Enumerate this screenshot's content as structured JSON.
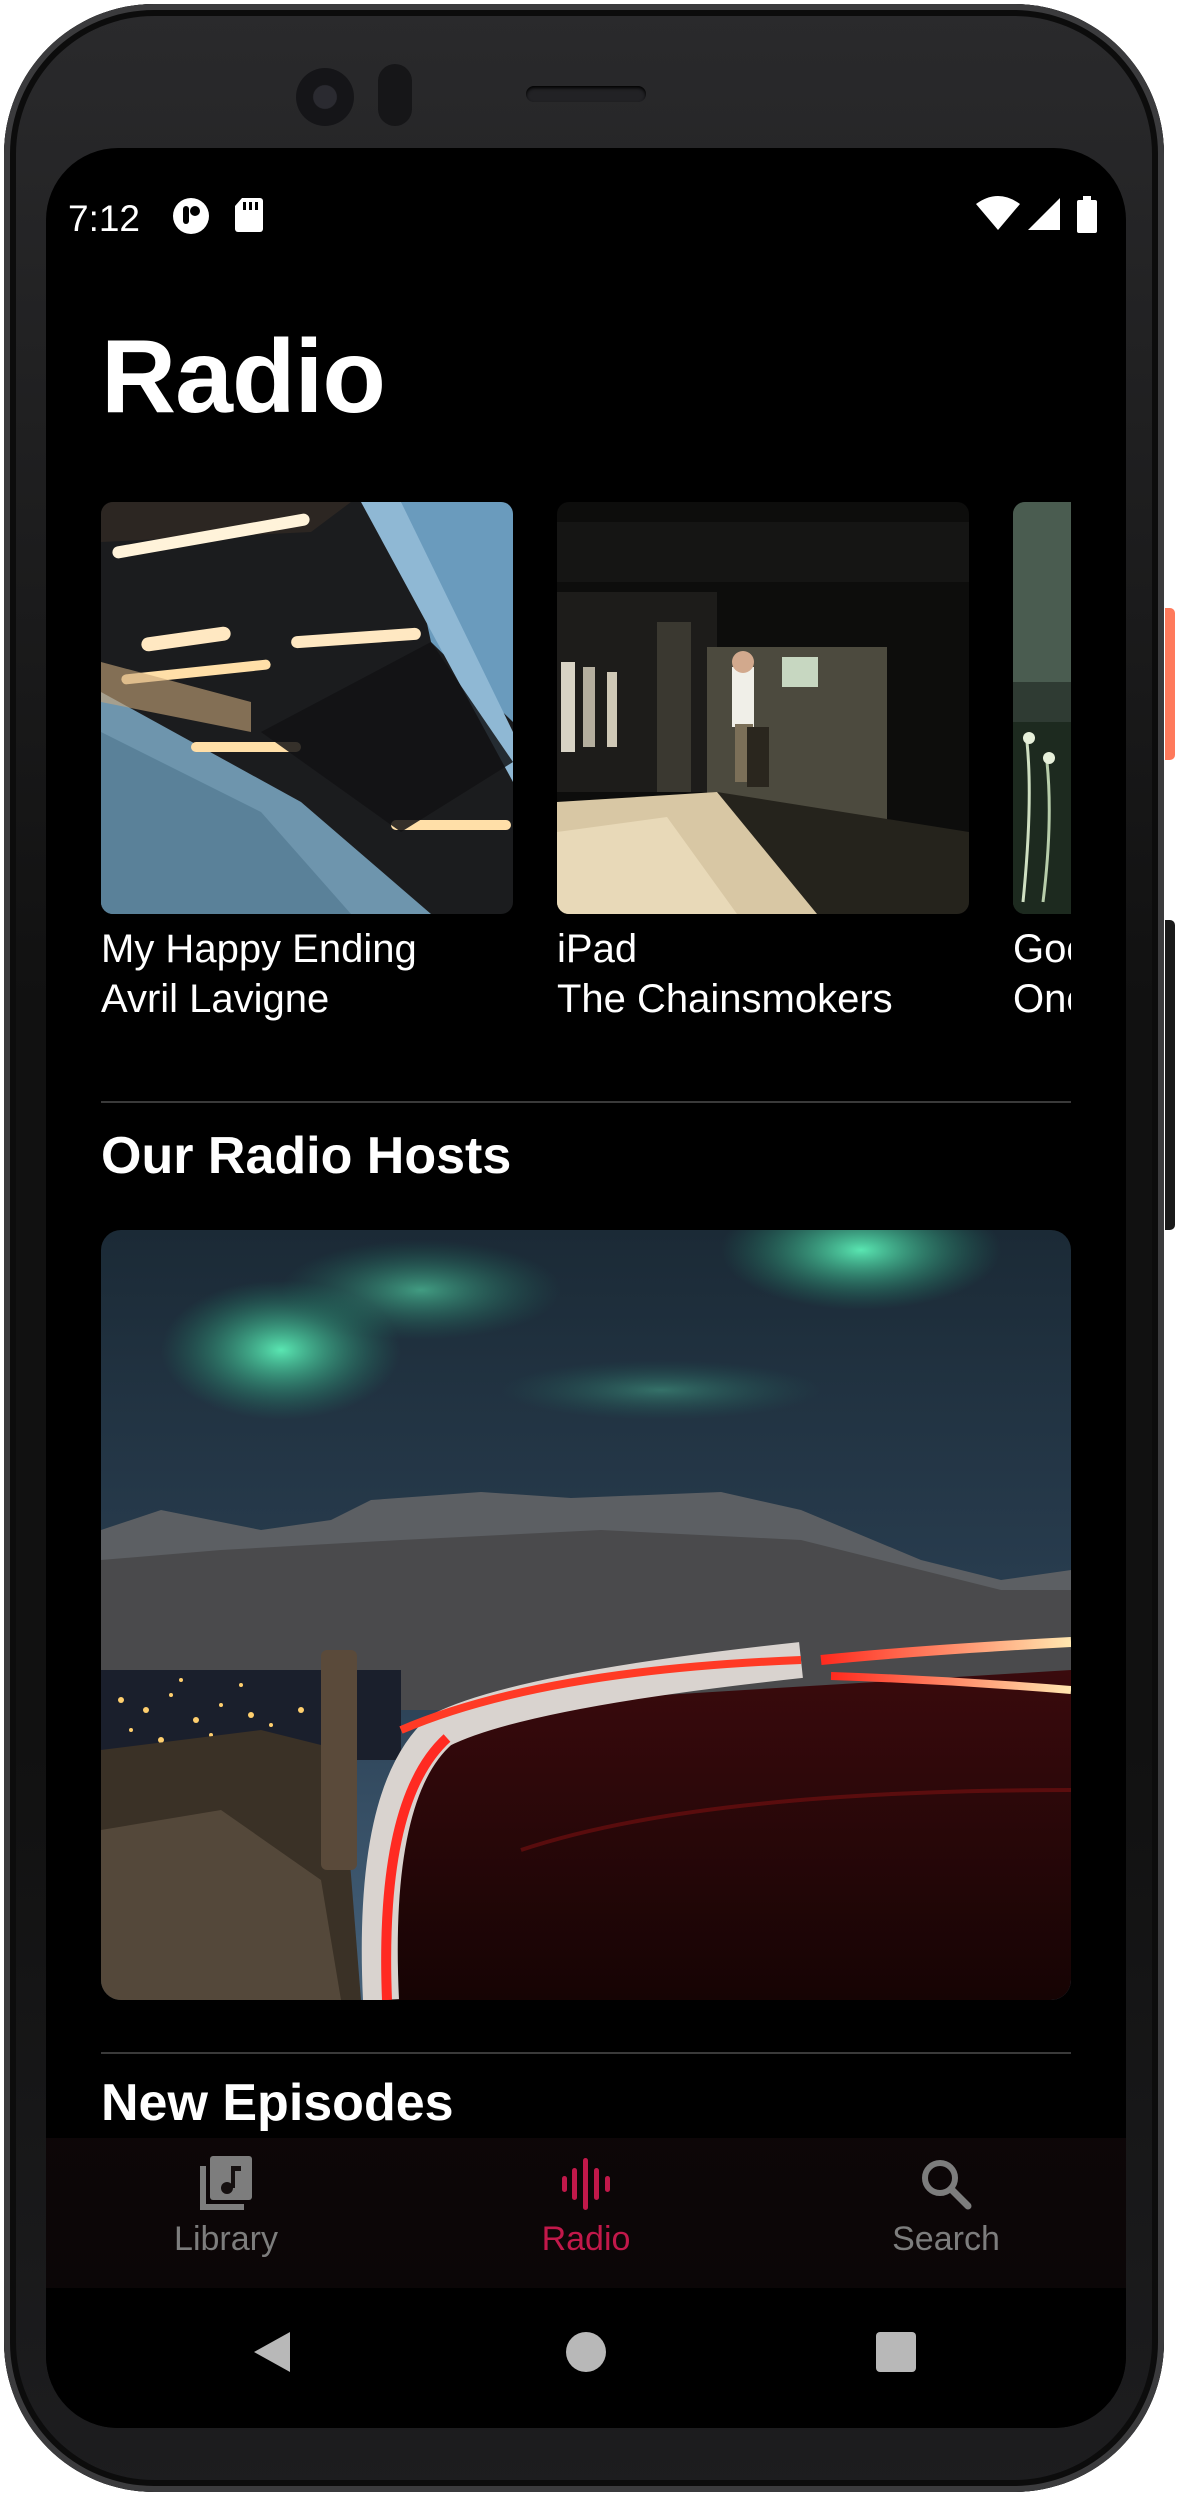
{
  "status_bar": {
    "time": "7:12",
    "left_icons": [
      "assistant-icon",
      "sd-card-icon"
    ],
    "right_icons": [
      "wifi-icon",
      "signal-icon",
      "battery-icon"
    ]
  },
  "page": {
    "title": "Radio"
  },
  "featured": [
    {
      "title": "My Happy Ending",
      "artist": "Avril Lavigne",
      "art": "architecture-lights-photo"
    },
    {
      "title": "iPad",
      "artist": "The Chainsmokers",
      "art": "man-in-doorway-photo"
    },
    {
      "title": "Goo",
      "artist": "One",
      "art": "green-meadow-photo"
    }
  ],
  "sections": {
    "hosts_title": "Our Radio Hosts",
    "hosts_image": "aurora-mountain-road-photo",
    "episodes_title": "New Episodes"
  },
  "tab_bar": {
    "active_color": "#c2184a",
    "inactive_color": "#7d7d7d",
    "items": [
      {
        "label": "Library",
        "icon": "music-library-icon"
      },
      {
        "label": "Radio",
        "icon": "radio-waves-icon"
      },
      {
        "label": "Search",
        "icon": "search-icon"
      }
    ]
  },
  "system_nav": {
    "buttons": [
      "back-icon",
      "home-icon",
      "recents-icon"
    ]
  }
}
